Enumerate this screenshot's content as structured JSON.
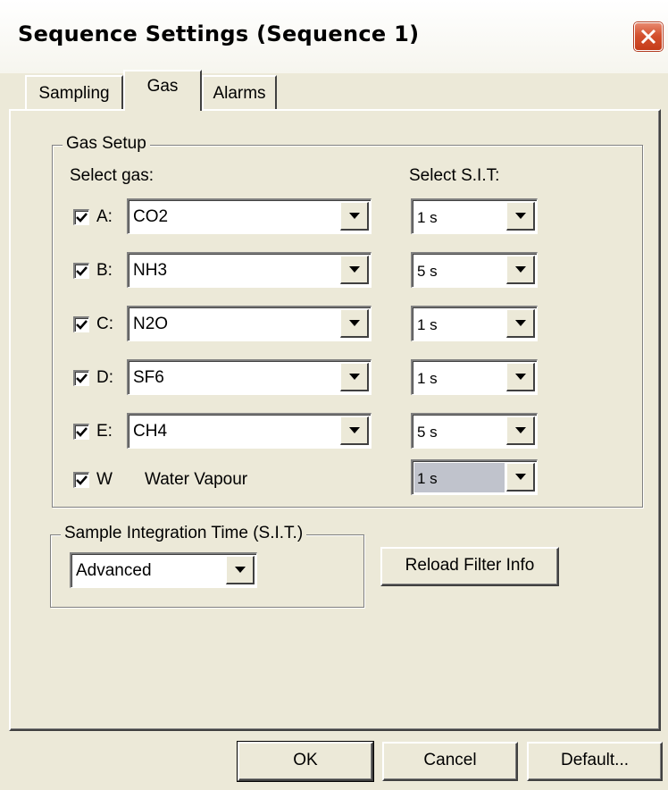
{
  "window": {
    "title": "Sequence Settings (Sequence 1)"
  },
  "tabs": [
    {
      "label": "Sampling",
      "active": false
    },
    {
      "label": "Gas",
      "active": true
    },
    {
      "label": "Alarms",
      "active": false
    }
  ],
  "gas_setup": {
    "group_title": "Gas Setup",
    "select_gas_label": "Select gas:",
    "select_sit_label": "Select S.I.T:",
    "rows": [
      {
        "letter": "A:",
        "checked": true,
        "gas": "CO2",
        "sit": "1 s"
      },
      {
        "letter": "B:",
        "checked": true,
        "gas": "NH3",
        "sit": "5 s"
      },
      {
        "letter": "C:",
        "checked": true,
        "gas": "N2O",
        "sit": "1 s"
      },
      {
        "letter": "D:",
        "checked": true,
        "gas": "SF6",
        "sit": "1 s"
      },
      {
        "letter": "E:",
        "checked": true,
        "gas": "CH4",
        "sit": "5 s"
      }
    ],
    "water": {
      "letter": "W",
      "checked": true,
      "label": "Water Vapour",
      "sit": "1 s"
    }
  },
  "sit_group": {
    "title": "Sample Integration Time (S.I.T.)",
    "selected": "Advanced"
  },
  "reload_button": "Reload Filter Info",
  "footer": {
    "ok": "OK",
    "cancel": "Cancel",
    "default": "Default..."
  },
  "colors": {
    "dialog_bg": "#ece9d8",
    "close_red": "#d4512f",
    "disabled_field": "#c0c3cc"
  },
  "icons": {
    "close": "close-x-icon",
    "dropdown": "chevron-down-icon",
    "checkbox": "check-icon"
  }
}
